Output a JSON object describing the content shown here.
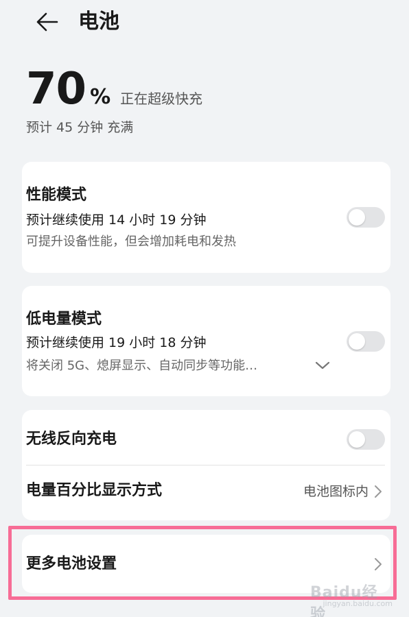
{
  "header": {
    "title": "电池",
    "back_icon": "arrow-left-icon"
  },
  "battery": {
    "level": "70",
    "unit": "%",
    "status": "正在超级快充",
    "estimate": "预计 45 分钟 充满"
  },
  "performance_mode": {
    "title": "性能模式",
    "usage": "预计继续使用 14 小时 19 分钟",
    "description": "可提升设备性能，但会增加耗电和发热",
    "enabled": false
  },
  "low_power_mode": {
    "title": "低电量模式",
    "usage": "预计继续使用 19 小时 18 分钟",
    "description": "将关闭 5G、熄屏显示、自动同步等功能…",
    "enabled": false
  },
  "wireless_reverse_charging": {
    "title": "无线反向充电",
    "enabled": false
  },
  "percentage_display": {
    "title": "电量百分比显示方式",
    "value": "电池图标内"
  },
  "more_settings": {
    "title": "更多电池设置"
  },
  "watermark": {
    "brand": "Baidu经验",
    "url": "jingyan.baidu.com"
  },
  "colors": {
    "background": "#f1f3f5",
    "card": "#ffffff",
    "toggle_off": "#e3e4e6",
    "highlight": "#f76d96"
  }
}
